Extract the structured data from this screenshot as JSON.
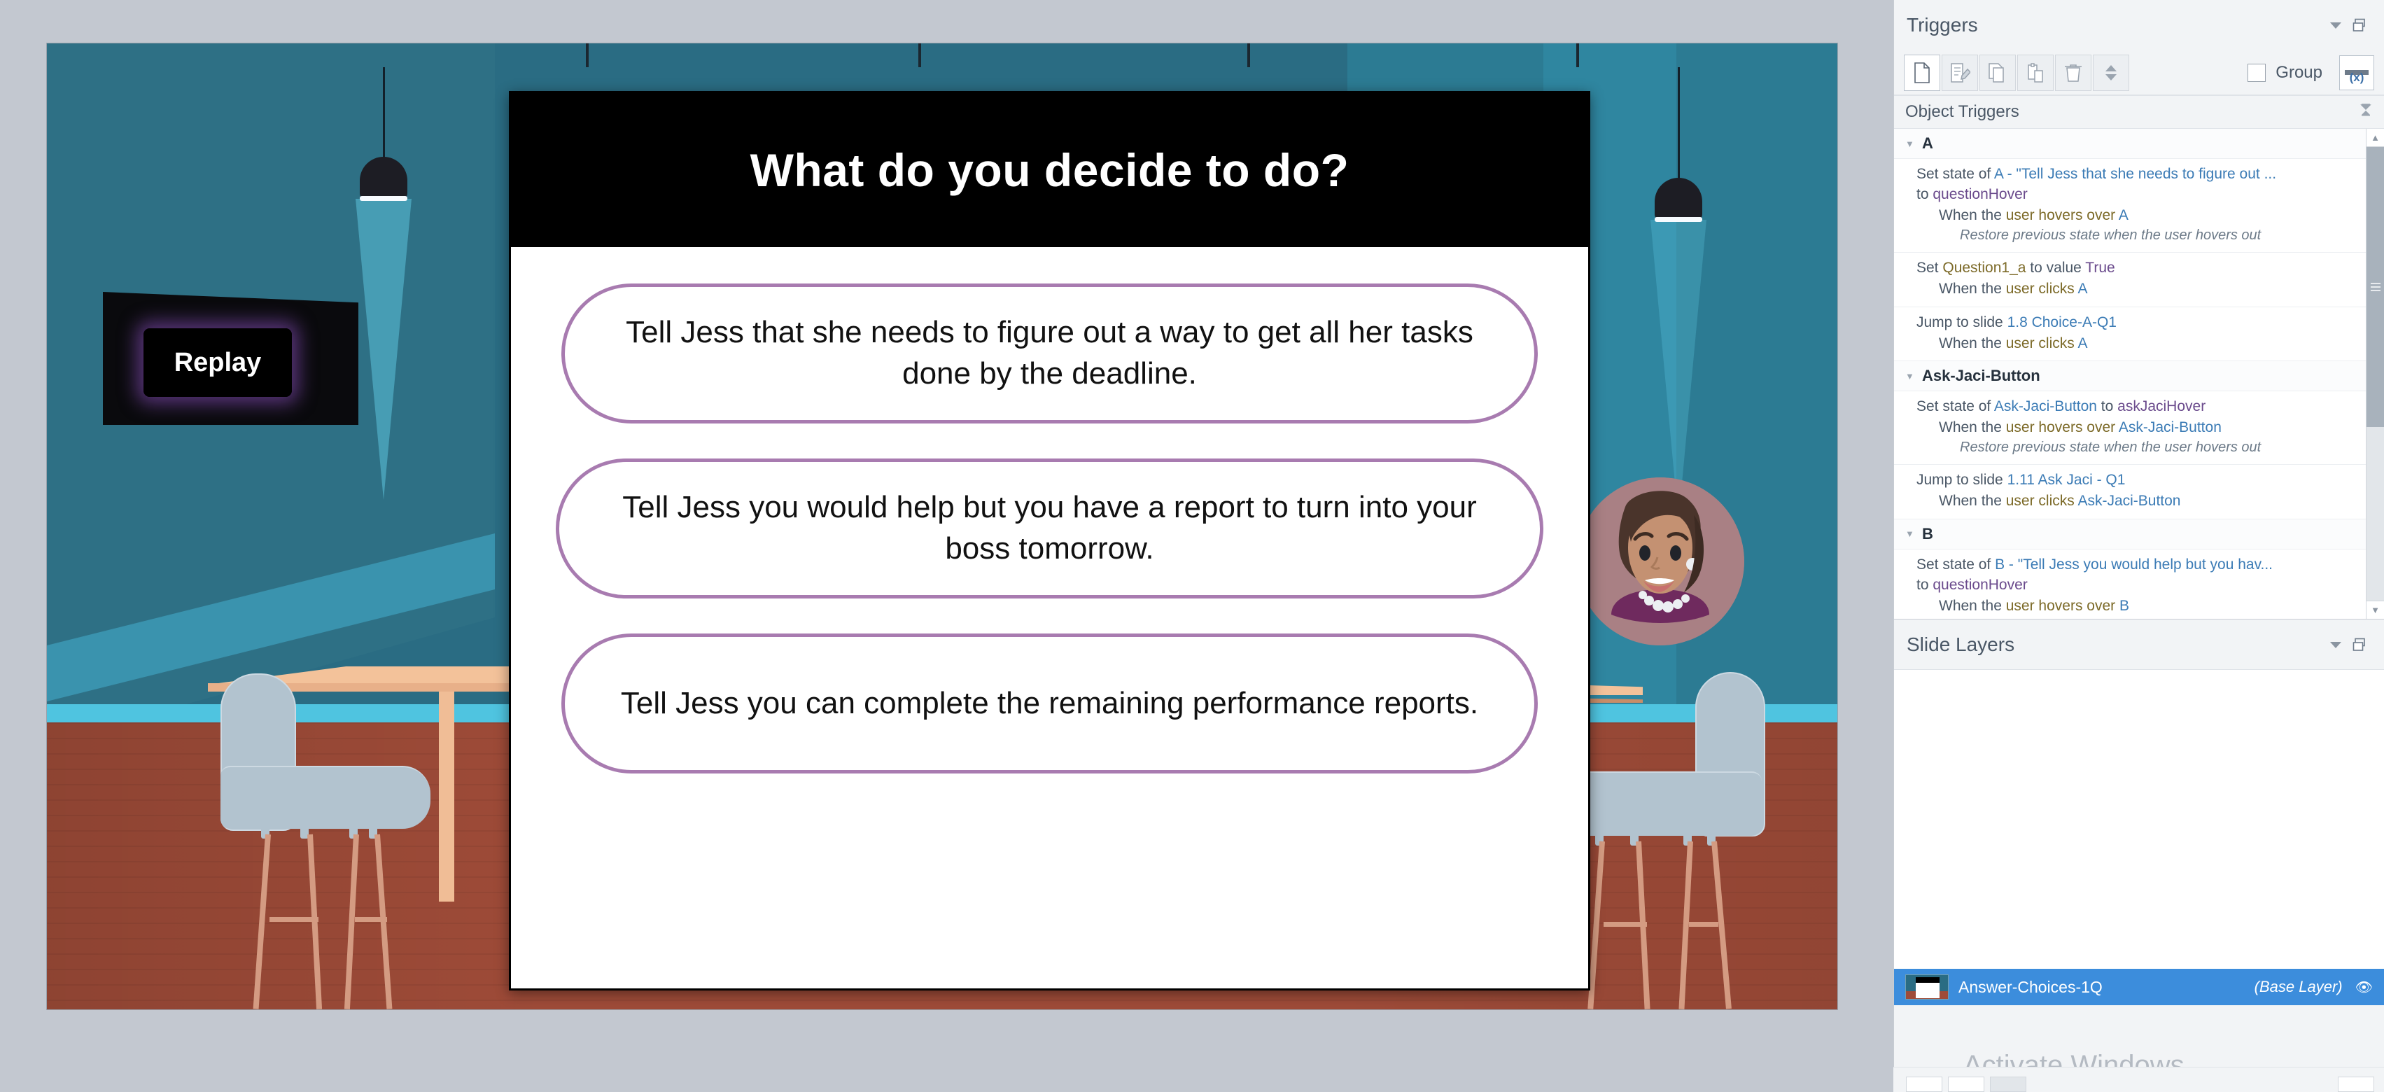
{
  "slide": {
    "question_title": "What do you decide to do?",
    "replay_label": "Replay",
    "choices": [
      {
        "id": "A",
        "text": "Tell Jess that she needs to figure out a way to get all her tasks done by the deadline."
      },
      {
        "id": "B",
        "text": "Tell Jess you would help but you have a report to turn into your boss tomorrow."
      },
      {
        "id": "C",
        "text": "Tell Jess you can complete the remaining performance reports."
      }
    ],
    "accent_purple": "#a87bb0",
    "wall_teal": "#2a6c83",
    "floor_brown": "#9e4b38"
  },
  "triggers_panel": {
    "title": "Triggers",
    "toolbar": {
      "new_label": "new-trigger",
      "edit_label": "edit-trigger",
      "copy_label": "copy-trigger",
      "paste_label": "paste-trigger",
      "delete_label": "delete-trigger",
      "move_up_label": "move-up",
      "move_down_label": "move-down",
      "group_label": "Group",
      "variables_label": "(x)"
    },
    "section_header": "Object Triggers",
    "groups": [
      {
        "name": "A",
        "items": [
          {
            "action_prefix": "Set state of ",
            "action_ref": "A - \"Tell Jess that she needs to figure out ...",
            "action_mid": " to ",
            "action_state": "questionHover",
            "when_prefix": "When the ",
            "when_kw": "user hovers over ",
            "when_ref": "A",
            "note": "Restore previous state when the user hovers out"
          },
          {
            "action_prefix": "Set ",
            "action_ref": "Question1_a",
            "action_mid": " to value ",
            "action_state": "True",
            "when_prefix": "When the ",
            "when_kw": "user clicks ",
            "when_ref": "A",
            "note": ""
          },
          {
            "action_prefix": "Jump to slide ",
            "action_ref": "1.8 Choice-A-Q1",
            "action_mid": "",
            "action_state": "",
            "when_prefix": "When the ",
            "when_kw": "user clicks ",
            "when_ref": "A",
            "note": ""
          }
        ]
      },
      {
        "name": "Ask-Jaci-Button",
        "items": [
          {
            "action_prefix": "Set state of ",
            "action_ref": "Ask-Jaci-Button",
            "action_mid": " to ",
            "action_state": "askJaciHover",
            "when_prefix": "When the ",
            "when_kw": "user hovers over ",
            "when_ref": "Ask-Jaci-Button",
            "note": "Restore previous state when the user hovers out"
          },
          {
            "action_prefix": "Jump to slide ",
            "action_ref": "1.11 Ask Jaci - Q1",
            "action_mid": "",
            "action_state": "",
            "when_prefix": "When the ",
            "when_kw": "user clicks ",
            "when_ref": "Ask-Jaci-Button",
            "note": ""
          }
        ]
      },
      {
        "name": "B",
        "items": [
          {
            "action_prefix": "Set state of ",
            "action_ref": "B - \"Tell Jess you would help but you hav...",
            "action_mid": " to ",
            "action_state": "questionHover",
            "when_prefix": "When the ",
            "when_kw": "user hovers over ",
            "when_ref": "B",
            "note": ""
          }
        ]
      }
    ]
  },
  "slide_layers_panel": {
    "title": "Slide Layers",
    "base_layer_name": "Answer-Choices-1Q",
    "base_layer_tag": "(Base Layer)"
  },
  "watermark": "Activate Windows"
}
